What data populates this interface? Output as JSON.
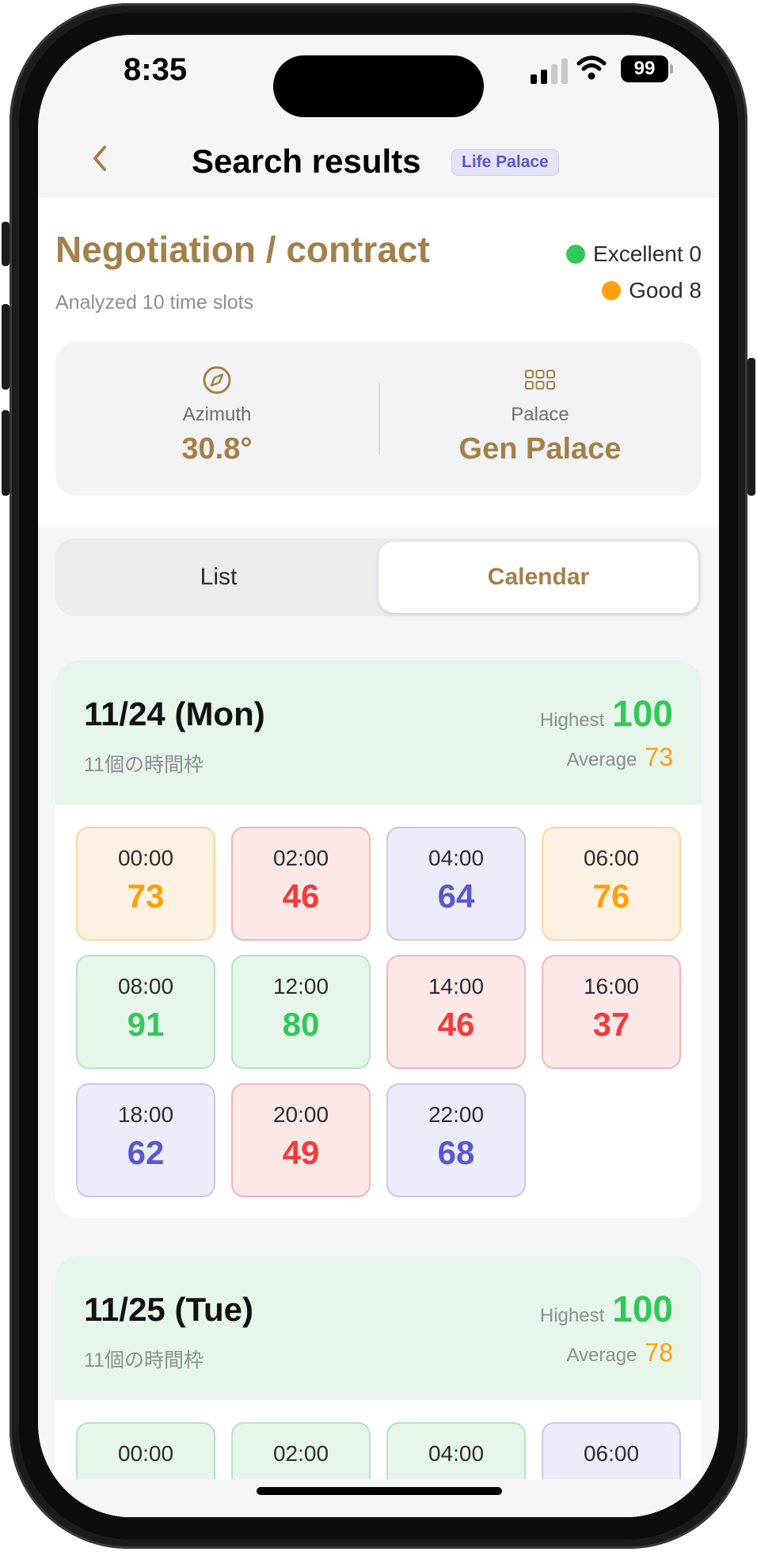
{
  "status_bar": {
    "time": "8:35",
    "battery": "99"
  },
  "nav": {
    "title": "Search results",
    "badge": "Life Palace"
  },
  "summary": {
    "title": "Negotiation / contract",
    "subtitle": "Analyzed 10 time slots",
    "legend": {
      "excellent_label": "Excellent 0",
      "good_label": "Good 8"
    },
    "azimuth": {
      "label": "Azimuth",
      "value": "30.8°"
    },
    "palace": {
      "label": "Palace",
      "value": "Gen Palace"
    }
  },
  "tabs": {
    "list": "List",
    "calendar": "Calendar",
    "selected": "Calendar"
  },
  "days": [
    {
      "date": "11/24 (Mon)",
      "subtitle": "11個の時間枠",
      "highest_label": "Highest",
      "highest_value": "100",
      "average_label": "Average",
      "average_value": "73",
      "slots": [
        {
          "time": "00:00",
          "score": "73",
          "tone": "orange"
        },
        {
          "time": "02:00",
          "score": "46",
          "tone": "red"
        },
        {
          "time": "04:00",
          "score": "64",
          "tone": "purple"
        },
        {
          "time": "06:00",
          "score": "76",
          "tone": "orange"
        },
        {
          "time": "08:00",
          "score": "91",
          "tone": "green"
        },
        {
          "time": "12:00",
          "score": "80",
          "tone": "green"
        },
        {
          "time": "14:00",
          "score": "46",
          "tone": "red"
        },
        {
          "time": "16:00",
          "score": "37",
          "tone": "red"
        },
        {
          "time": "18:00",
          "score": "62",
          "tone": "purple"
        },
        {
          "time": "20:00",
          "score": "49",
          "tone": "red"
        },
        {
          "time": "22:00",
          "score": "68",
          "tone": "purple"
        }
      ]
    },
    {
      "date": "11/25 (Tue)",
      "subtitle": "11個の時間枠",
      "highest_label": "Highest",
      "highest_value": "100",
      "average_label": "Average",
      "average_value": "78",
      "slots": [
        {
          "time": "00:00",
          "tone": "green"
        },
        {
          "time": "02:00",
          "tone": "green"
        },
        {
          "time": "04:00",
          "tone": "green"
        },
        {
          "time": "06:00",
          "tone": "purple"
        }
      ]
    }
  ],
  "colors": {
    "accent": "#a38049",
    "excellent": "#34c759",
    "good": "#ff9f0a",
    "bad": "#f23b3b",
    "neutral": "#5a57d0"
  },
  "icons": {
    "back": "chevron-left-icon",
    "azimuth": "compass-icon",
    "palace": "grid-icon"
  }
}
